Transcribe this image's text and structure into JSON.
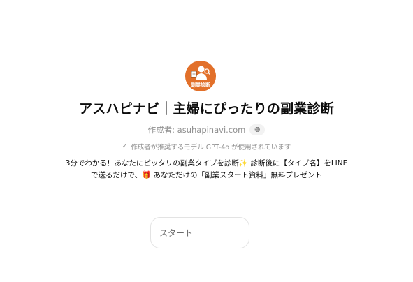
{
  "gpt": {
    "avatar_text": "副業診断",
    "title": "アスハピナビ｜主婦にぴったりの副業診断",
    "author": "作成者: asuhapinavi.com",
    "globe_icon": "globe-icon",
    "model_notice": "作成者が推奨するモデル GPT-4o が使用されています",
    "check_icon": "check-icon",
    "description_line1": "3分でわかる！あなたにピッタリの副業タイプを診断✨ 診断後に【タイプ名】をLINE",
    "description_line2": "で送るだけで、🎁 あなただけの「副業スタート資料」無料プレゼント",
    "starter": "スタート"
  },
  "colors": {
    "avatar_bg": "#e2702a",
    "muted_text": "#8f8f8f"
  }
}
